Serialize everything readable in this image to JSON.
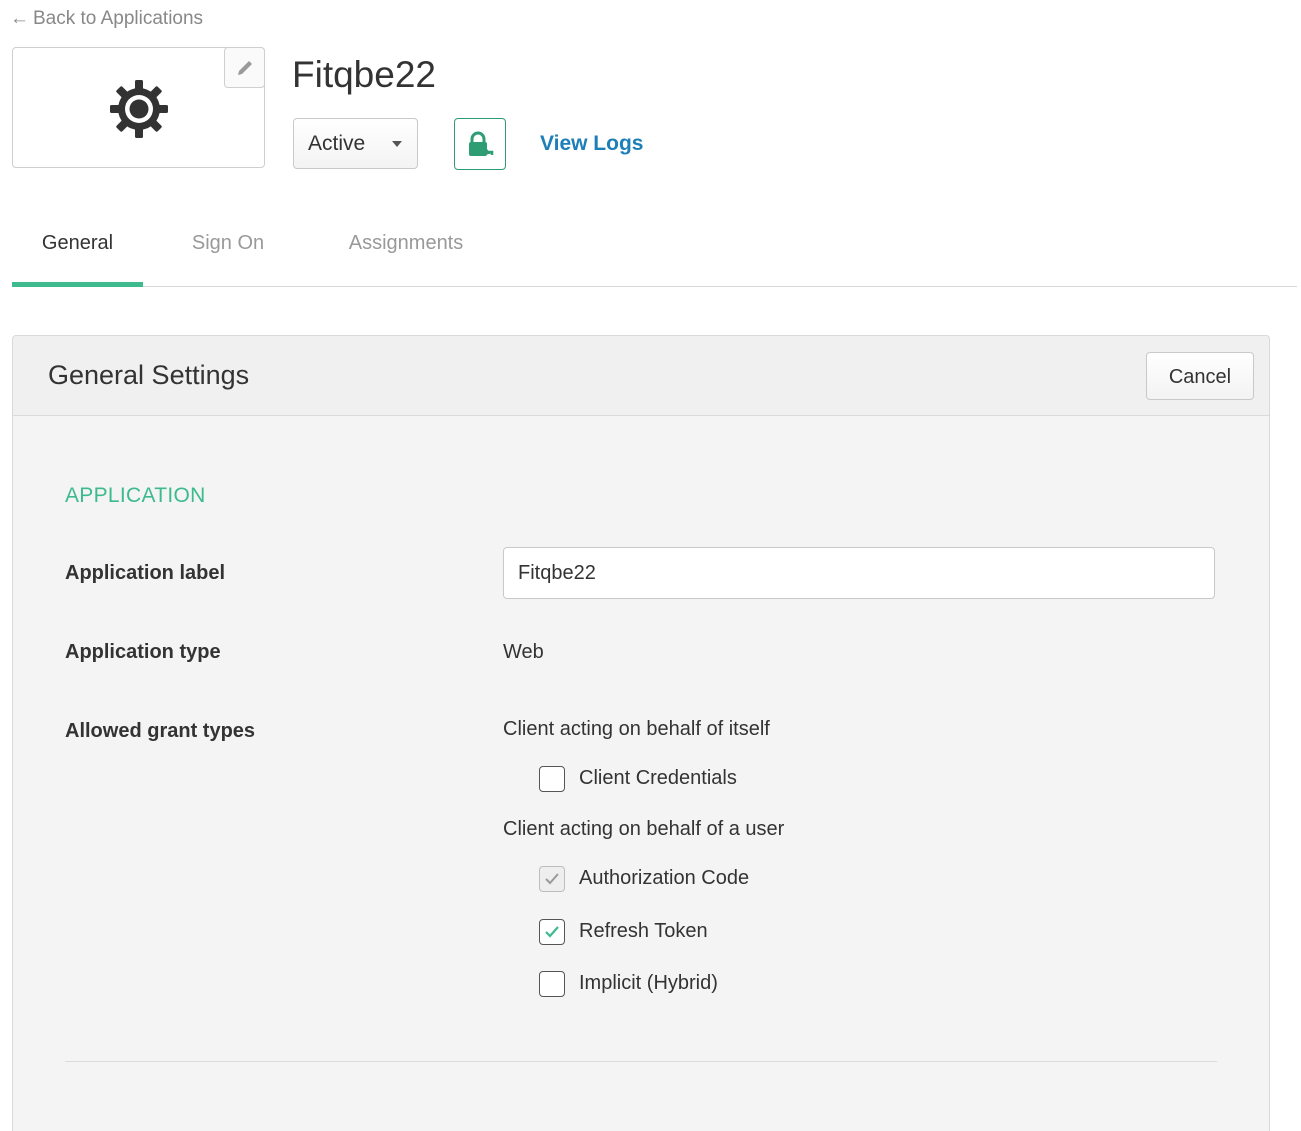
{
  "nav": {
    "back_arrow": "←",
    "back_label": "Back to Applications"
  },
  "app": {
    "logo_icon": "gear-icon",
    "edit_icon": "pencil-icon",
    "name": "Fitqbe22",
    "status": "Active",
    "push_icon": "lock-key-icon",
    "view_logs": "View Logs"
  },
  "tabs": [
    {
      "label": "General",
      "active": true
    },
    {
      "label": "Sign On",
      "active": false
    },
    {
      "label": "Assignments",
      "active": false
    }
  ],
  "panel": {
    "title": "General Settings",
    "cancel_label": "Cancel",
    "section_heading": "APPLICATION",
    "fields": {
      "app_label": {
        "label": "Application label",
        "value": "Fitqbe22"
      },
      "app_type": {
        "label": "Application type",
        "value": "Web"
      },
      "grant_types": {
        "label": "Allowed grant types",
        "group_self": "Client acting on behalf of itself",
        "group_user": "Client acting on behalf of a user",
        "options": [
          {
            "label": "Client Credentials",
            "checked": false,
            "disabled": false
          },
          {
            "label": "Authorization Code",
            "checked": true,
            "disabled": true
          },
          {
            "label": "Refresh Token",
            "checked": true,
            "disabled": false
          },
          {
            "label": "Implicit (Hybrid)",
            "checked": false,
            "disabled": false
          }
        ]
      }
    }
  },
  "colors": {
    "accent": "#3dba8e",
    "link": "#1d7fb7",
    "push_button": "#2e9d74"
  }
}
